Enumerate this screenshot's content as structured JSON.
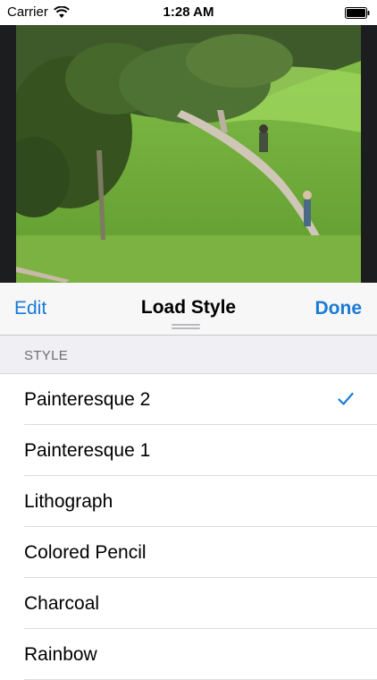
{
  "status_bar": {
    "carrier": "Carrier",
    "time": "1:28 AM",
    "wifi_icon": "wifi-icon",
    "battery_icon": "battery-icon"
  },
  "photo": {
    "description_icon": "landscape-photo"
  },
  "nav": {
    "edit_label": "Edit",
    "title": "Load Style",
    "done_label": "Done"
  },
  "section": {
    "header": "STYLE"
  },
  "styles": [
    {
      "label": "Painteresque 2",
      "selected": true
    },
    {
      "label": "Painteresque 1",
      "selected": false
    },
    {
      "label": "Lithograph",
      "selected": false
    },
    {
      "label": "Colored Pencil",
      "selected": false
    },
    {
      "label": "Charcoal",
      "selected": false
    },
    {
      "label": "Rainbow",
      "selected": false
    }
  ],
  "colors": {
    "accent": "#1a7bd6",
    "section_bg": "#efeff4",
    "photo_bg": "#1c1d1f"
  }
}
